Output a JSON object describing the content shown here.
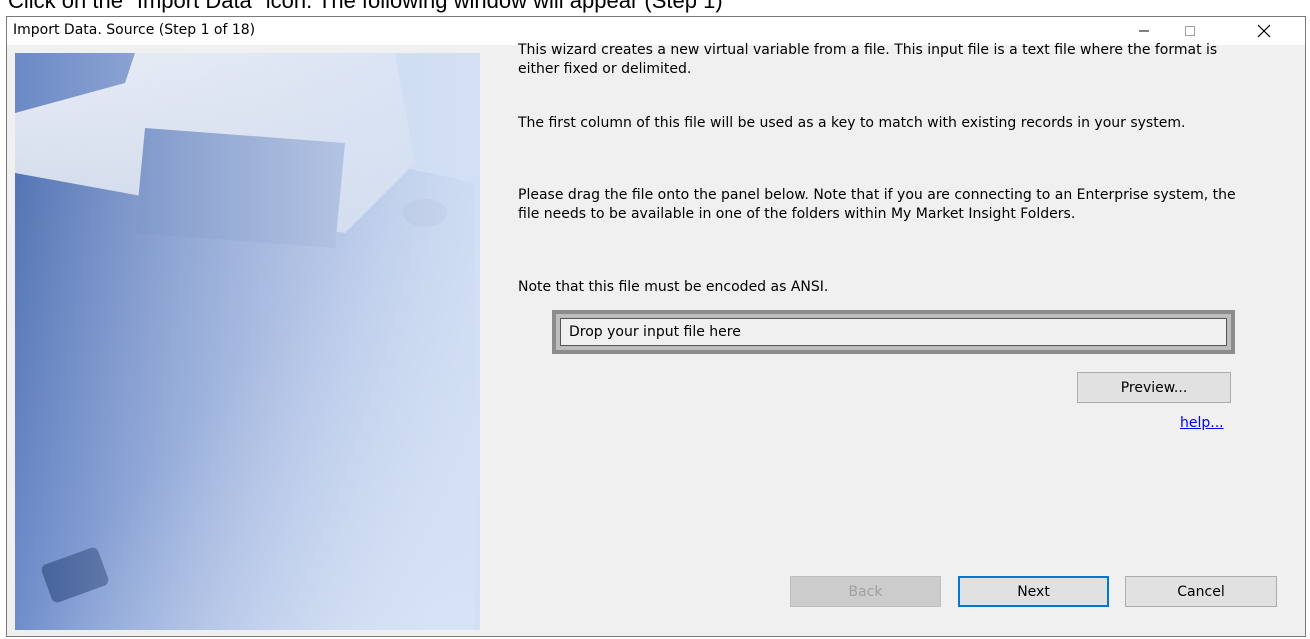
{
  "caption": "Click on the \"Import Data\" icon. The following window will appear (Step 1)",
  "window": {
    "title": "Import Data.  Source (Step 1 of 18)",
    "controls": {
      "minimize": "—",
      "maximize": "☐",
      "close": "✕"
    }
  },
  "content": {
    "paragraphs": [
      "This wizard creates a new virtual variable from a file. This input file is a text file where the format is either fixed or delimited.",
      "The first column of this file will be used as a key to match with existing records in your system.",
      "Please drag the file onto the panel below. Note that if you are connecting to an Enterprise system, the file needs to be available in one of the folders within My Market Insight Folders.",
      "Note that this file must be encoded as ANSI."
    ],
    "drop_panel_text": "Drop your input file here",
    "preview_label": "Preview...",
    "help_label": "help..."
  },
  "footer": {
    "back_label": "Back",
    "next_label": "Next",
    "cancel_label": "Cancel"
  },
  "side_image_icon": "floppy-disk-icon"
}
